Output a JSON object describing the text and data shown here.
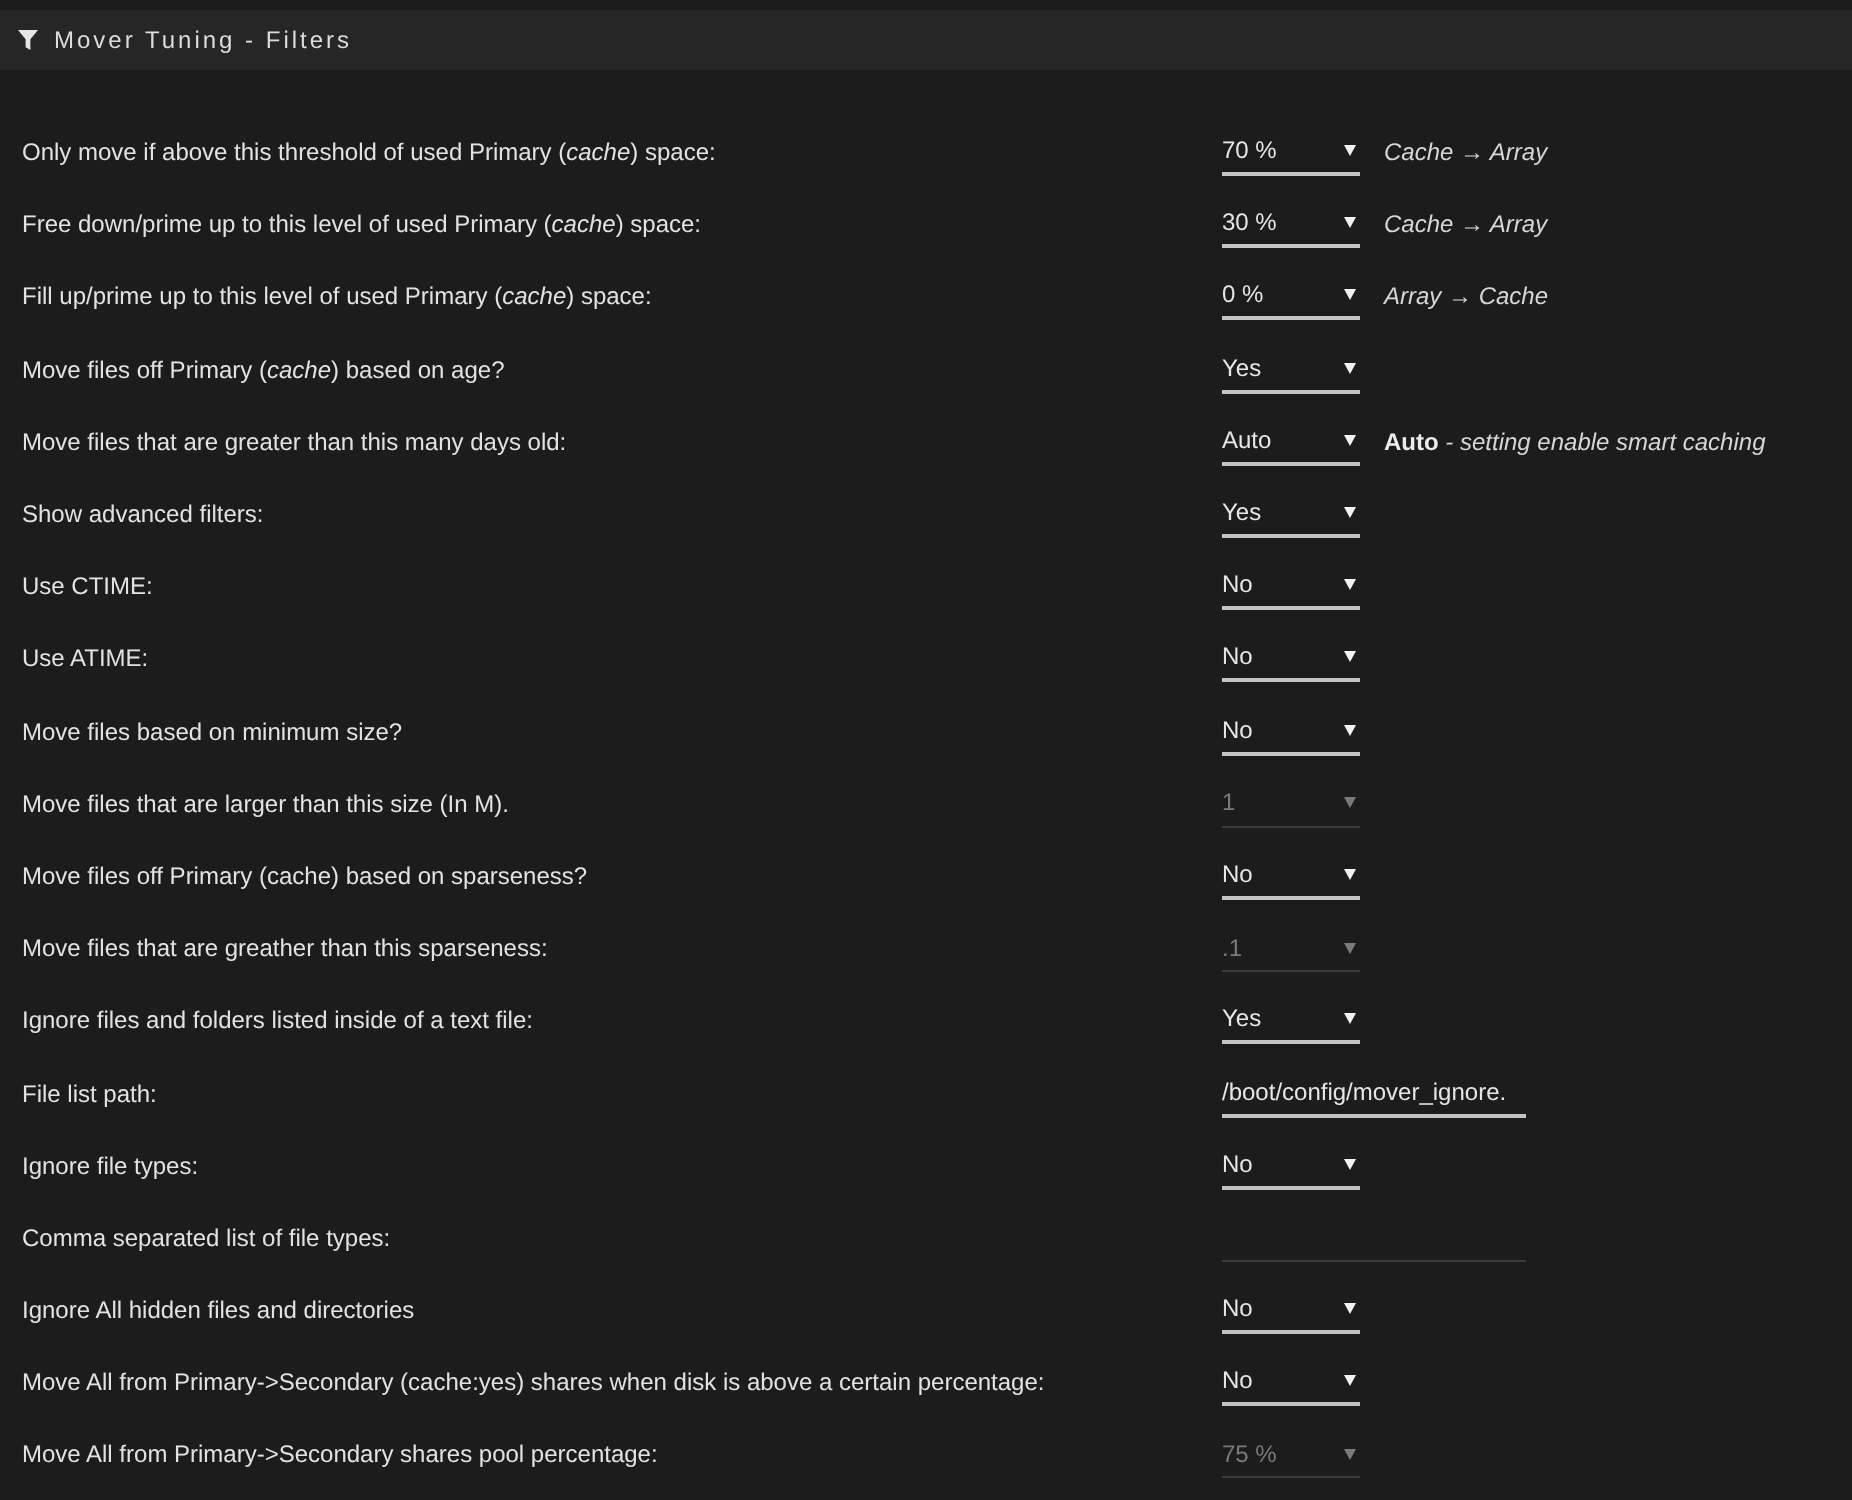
{
  "panel": {
    "title": "Mover Tuning - Filters"
  },
  "settings": [
    {
      "label": "Only move if above this threshold of used Primary (*cache*) space:",
      "kind": "select",
      "value": "70 %",
      "disabled": false,
      "note": "Cache → Array"
    },
    {
      "label": "Free down/prime up to this level of used Primary (*cache*) space:",
      "kind": "select",
      "value": "30 %",
      "disabled": false,
      "note": "Cache → Array"
    },
    {
      "label": "Fill up/prime up to this level of used Primary (*cache*) space:",
      "kind": "select",
      "value": "0 %",
      "disabled": false,
      "note": "Array → Cache"
    },
    {
      "label": "Move files off Primary (*cache*) based on age?",
      "kind": "select",
      "value": "Yes",
      "disabled": false
    },
    {
      "label": "Move files that are greater than this many days old:",
      "kind": "select",
      "value": "Auto",
      "disabled": false,
      "note": "**Auto** - setting enable smart caching"
    },
    {
      "label": "Show advanced filters:",
      "kind": "select",
      "value": "Yes",
      "disabled": false
    },
    {
      "label": "Use CTIME:",
      "kind": "select",
      "value": "No",
      "disabled": false
    },
    {
      "label": "Use ATIME:",
      "kind": "select",
      "value": "No",
      "disabled": false
    },
    {
      "label": "Move files based on minimum size?",
      "kind": "select",
      "value": "No",
      "disabled": false
    },
    {
      "label": "Move files that are larger than this size (In M).",
      "kind": "select",
      "value": "1",
      "disabled": true
    },
    {
      "label": "Move files off Primary (cache) based on sparseness?",
      "kind": "select",
      "value": "No",
      "disabled": false
    },
    {
      "label": "Move files that are greather than this sparseness:",
      "kind": "select",
      "value": ".1",
      "disabled": true
    },
    {
      "label": "Ignore files and folders listed inside of a text file:",
      "kind": "select",
      "value": "Yes",
      "disabled": false
    },
    {
      "label": "File list path:",
      "kind": "text",
      "value": "/boot/config/mover_ignore.",
      "disabled": false
    },
    {
      "label": "Ignore file types:",
      "kind": "select",
      "value": "No",
      "disabled": false
    },
    {
      "label": "Comma separated list of file types:",
      "kind": "text",
      "disabled": true
    },
    {
      "label": "Ignore All hidden files and directories",
      "kind": "select",
      "value": "No",
      "disabled": false
    },
    {
      "label": "Move All from Primary->Secondary (cache:yes) shares when disk is above a certain percentage:",
      "kind": "select",
      "value": "No",
      "disabled": false
    },
    {
      "label": "Move All from Primary->Secondary shares pool percentage:",
      "kind": "select",
      "value": "75 %",
      "disabled": true
    }
  ]
}
